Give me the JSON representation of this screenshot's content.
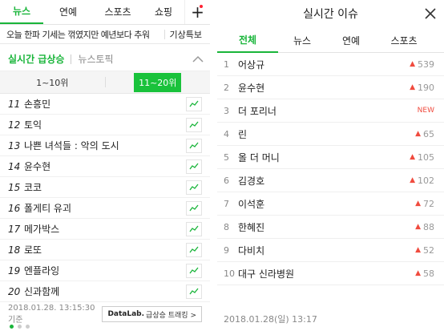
{
  "left": {
    "nav_tabs": [
      {
        "label": "뉴스",
        "active": true
      },
      {
        "label": "연예",
        "active": false
      },
      {
        "label": "스포츠",
        "active": false
      },
      {
        "label": "쇼핑",
        "active": false
      }
    ],
    "plus_label": "+",
    "weather_text": "오늘 한파 기세는 꺾였지만 예년보다 추워",
    "weather_link": "기상특보",
    "rank_title": "실시간 급상승",
    "rank_sub": "뉴스토픽",
    "toggle": {
      "opt1": "1~10위",
      "opt2": "11~20위"
    },
    "rank_items": [
      {
        "num": "11",
        "keyword": "손흥민"
      },
      {
        "num": "12",
        "keyword": "토익"
      },
      {
        "num": "13",
        "keyword": "나쁜 녀석들 : 악의 도시"
      },
      {
        "num": "14",
        "keyword": "윤수현"
      },
      {
        "num": "15",
        "keyword": "코코"
      },
      {
        "num": "16",
        "keyword": "폴게티 유괴"
      },
      {
        "num": "17",
        "keyword": "메가박스"
      },
      {
        "num": "18",
        "keyword": "로또"
      },
      {
        "num": "19",
        "keyword": "엔플라잉"
      },
      {
        "num": "20",
        "keyword": "신과함께"
      }
    ],
    "timestamp": "2018.01.28. 13:15:30 기준",
    "datalab_bold": "DataLab.",
    "datalab_text": "급상승 트래킹 >"
  },
  "right": {
    "title": "실시간 이슈",
    "tabs": [
      {
        "label": "전체",
        "active": true
      },
      {
        "label": "뉴스",
        "active": false
      },
      {
        "label": "연예",
        "active": false
      },
      {
        "label": "스포츠",
        "active": false
      }
    ],
    "issues": [
      {
        "num": "1",
        "keyword": "어상규",
        "change": "539",
        "new": false
      },
      {
        "num": "2",
        "keyword": "윤수현",
        "change": "190",
        "new": false
      },
      {
        "num": "3",
        "keyword": "더 포리너",
        "change": "NEW",
        "new": true
      },
      {
        "num": "4",
        "keyword": "린",
        "change": "65",
        "new": false
      },
      {
        "num": "5",
        "keyword": "올 더 머니",
        "change": "105",
        "new": false
      },
      {
        "num": "6",
        "keyword": "김경호",
        "change": "102",
        "new": false
      },
      {
        "num": "7",
        "keyword": "이석훈",
        "change": "72",
        "new": false
      },
      {
        "num": "8",
        "keyword": "한혜진",
        "change": "88",
        "new": false
      },
      {
        "num": "9",
        "keyword": "다비치",
        "change": "52",
        "new": false
      },
      {
        "num": "10",
        "keyword": "대구 신라병원",
        "change": "58",
        "new": false
      }
    ],
    "footer_time": "2018.01.28(일) 13:17"
  },
  "colors": {
    "accent": "#19b53a",
    "rise": "#f04b3e"
  },
  "icons": {
    "plus": "plus-icon",
    "chevron": "chevron-up-icon",
    "graph": "trend-graph-icon",
    "close": "close-icon",
    "arrow": "up-arrow-icon"
  }
}
